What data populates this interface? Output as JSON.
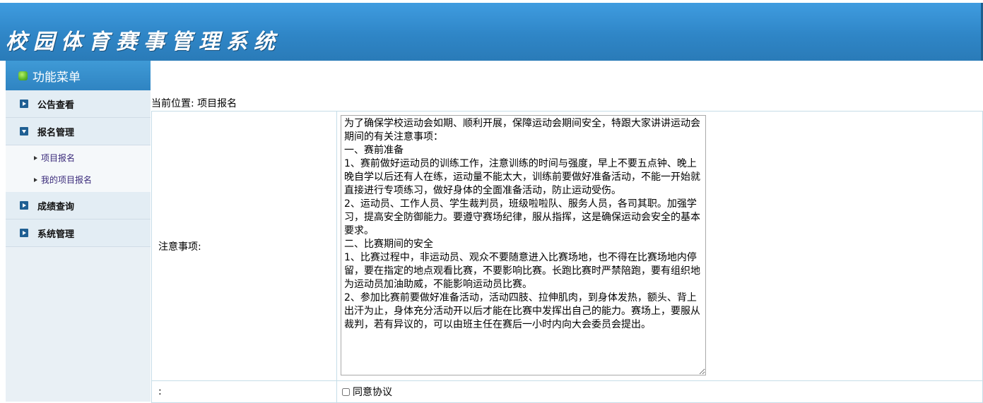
{
  "app": {
    "title": "校园体育赛事管理系统"
  },
  "sidebar": {
    "header": "功能菜单",
    "items": [
      {
        "label": "公告查看",
        "expanded": false
      },
      {
        "label": "报名管理",
        "expanded": true,
        "children": [
          "项目报名",
          "我的项目报名"
        ]
      },
      {
        "label": "成绩查询",
        "expanded": false
      },
      {
        "label": "系统管理",
        "expanded": false
      }
    ]
  },
  "breadcrumb": "当前位置: 项目报名",
  "form": {
    "notice_label": "注意事项:",
    "notice_text": "为了确保学校运动会如期、顺利开展，保障运动会期间安全，特跟大家讲讲运动会期间的有关注意事项：\n一、赛前准备\n1、赛前做好运动员的训练工作，注意训练的时间与强度，早上不要五点钟、晚上晚自学以后还有人在练，运动量不能太大，训练前要做好准备活动，不能一开始就直接进行专项练习，做好身体的全面准备活动，防止运动受伤。\n2、运动员、工作人员、学生裁判员，班级啦啦队、服务人员，各司其职。加强学习，提高安全防御能力。要遵守赛场纪律，服从指挥，这是确保运动会安全的基本要求。\n二、比赛期间的安全\n1、比赛过程中，非运动员、观众不要随意进入比赛场地，也不得在比赛场地内停留，要在指定的地点观看比赛，不要影响比赛。长跑比赛时严禁陪跑，要有组织地为运动员加油助威，不能影响运动员比赛。\n2、参加比赛前要做好准备活动，活动四肢、拉伸肌肉，到身体发热，额头、背上出汗为止，身体充分活动开以后才能在比赛中发挥出自己的能力。赛场上，要服从裁判，若有异议的，可以由班主任在赛后一小时内向大会委员会提出。",
    "agree_row_label": ":",
    "agree_checkbox_label": "同意协议",
    "agree_checked": false
  },
  "colors": {
    "header_blue": "#2f86c7",
    "sidebar_bg": "#e9f0f5",
    "menu_icon": "#1f5f93",
    "submenu_link": "#3a2a7a"
  }
}
